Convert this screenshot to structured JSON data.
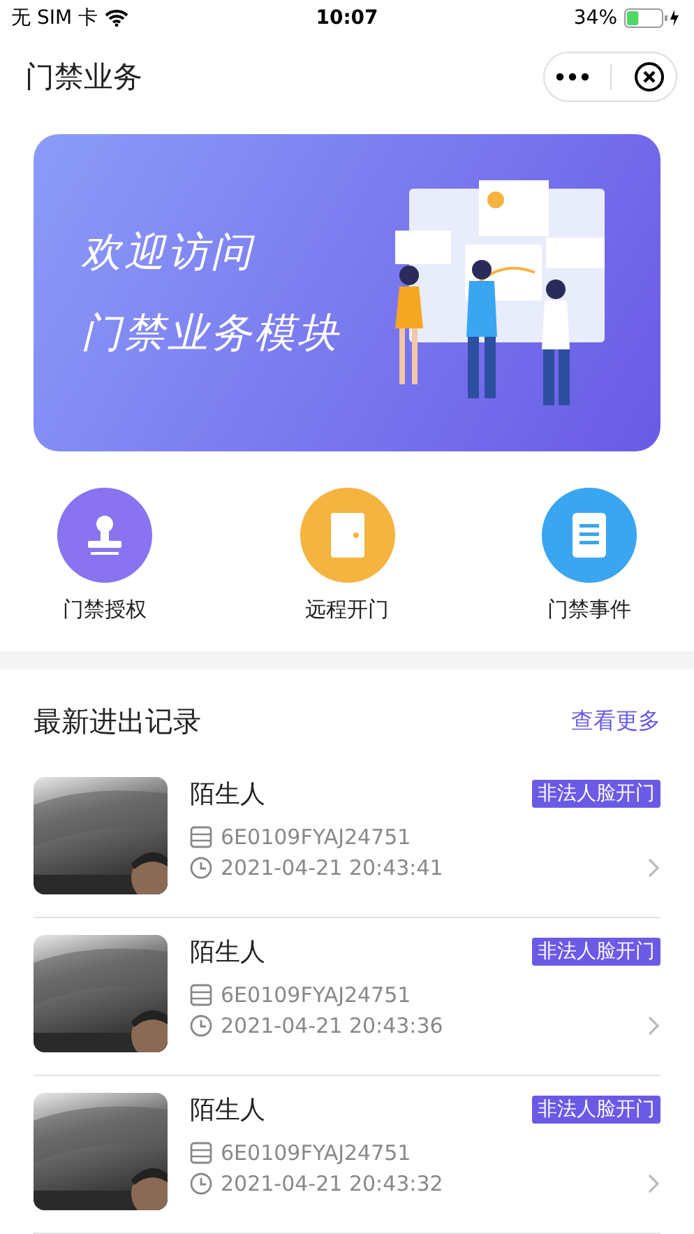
{
  "status_bar": {
    "carrier": "无 SIM 卡",
    "time": "10:07",
    "battery_text": "34%",
    "battery": {
      "level": 0.34
    }
  },
  "nav": {
    "title": "门禁业务"
  },
  "banner": {
    "lines": [
      "欢迎访问",
      "门禁业务模块"
    ]
  },
  "shortcuts": [
    {
      "label": "门禁授权",
      "kind": "stamp",
      "color": "#8a73f0"
    },
    {
      "label": "远程开门",
      "kind": "door",
      "color": "#f5b340"
    },
    {
      "label": "门禁事件",
      "kind": "doc",
      "color": "#3aa5f0"
    }
  ],
  "records": {
    "title": "最新进出记录",
    "more": "查看更多",
    "rows": [
      {
        "name": "陌生人",
        "tag": "非法人脸开门",
        "device": "6E0109FYAJ24751",
        "time": "2021-04-21 20:43:41"
      },
      {
        "name": "陌生人",
        "tag": "非法人脸开门",
        "device": "6E0109FYAJ24751",
        "time": "2021-04-21 20:43:36"
      },
      {
        "name": "陌生人",
        "tag": "非法人脸开门",
        "device": "6E0109FYAJ24751",
        "time": "2021-04-21 20:43:32"
      }
    ]
  }
}
